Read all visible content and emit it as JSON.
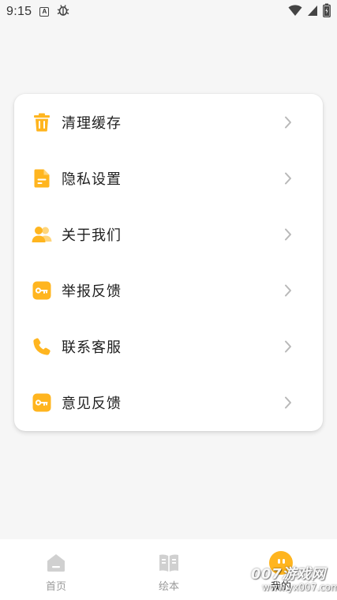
{
  "status_bar": {
    "time": "9:15",
    "indicator_letter": "A",
    "icons": [
      "a-notification-icon",
      "debug-icon",
      "wifi-icon",
      "signal-icon",
      "battery-icon"
    ]
  },
  "colors": {
    "accent": "#ffb51f",
    "chevron": "#b8b8b8",
    "tab_inactive": "#d0d0d0",
    "background": "#f6f6f6"
  },
  "menu": {
    "items": [
      {
        "label": "清理缓存",
        "icon": "trash-icon"
      },
      {
        "label": "隐私设置",
        "icon": "document-icon"
      },
      {
        "label": "关于我们",
        "icon": "users-icon"
      },
      {
        "label": "举报反馈",
        "icon": "key-icon"
      },
      {
        "label": "联系客服",
        "icon": "phone-icon"
      },
      {
        "label": "意见反馈",
        "icon": "key-icon"
      }
    ]
  },
  "tabs": [
    {
      "label": "首页",
      "icon": "home-icon",
      "active": false
    },
    {
      "label": "绘本",
      "icon": "book-icon",
      "active": false
    },
    {
      "label": "我的",
      "icon": "mine-face-icon",
      "active": true
    }
  ],
  "watermark": {
    "main": "007游戏网",
    "sub": "www.yx007.com"
  }
}
